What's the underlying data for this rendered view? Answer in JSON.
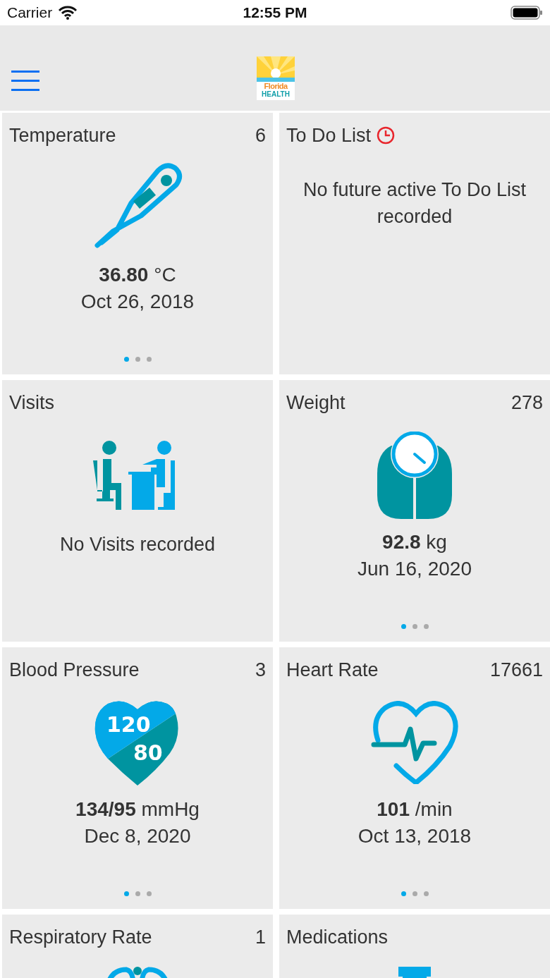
{
  "status_bar": {
    "carrier": "Carrier",
    "time": "12:55 PM"
  },
  "header": {
    "logo": {
      "line_1": "Florida",
      "line_2": "HEALTH"
    }
  },
  "tiles": [
    {
      "kind": "reading",
      "title": "Temperature",
      "count": "6",
      "value": "36.80",
      "unit": "°C",
      "date": "Oct 26, 2018",
      "pages": [
        {
          "selected": true
        },
        {
          "selected": false
        },
        {
          "selected": false
        }
      ]
    },
    {
      "kind": "message",
      "title": "To Do List",
      "message": "No future active To Do List recorded"
    },
    {
      "kind": "empty",
      "title": "Visits",
      "message": "No Visits recorded"
    },
    {
      "kind": "reading",
      "title": "Weight",
      "count": "278",
      "value": "92.8",
      "unit": "kg",
      "date": "Jun 16, 2020",
      "pages": [
        {
          "selected": true
        },
        {
          "selected": false
        },
        {
          "selected": false
        }
      ]
    },
    {
      "kind": "reading",
      "icon_text": [
        "120",
        "80"
      ],
      "title": "Blood Pressure",
      "count": "3",
      "value": "134/95",
      "unit": "mmHg",
      "date": "Dec 8, 2020",
      "pages": [
        {
          "selected": true
        },
        {
          "selected": false
        },
        {
          "selected": false
        }
      ]
    },
    {
      "kind": "reading",
      "title": "Heart Rate",
      "count": "17661",
      "value": "101",
      "unit": "/min",
      "date": "Oct 13, 2018",
      "pages": [
        {
          "selected": true
        },
        {
          "selected": false
        },
        {
          "selected": false
        }
      ]
    },
    {
      "kind": "cut",
      "title": "Respiratory Rate",
      "count": "1"
    },
    {
      "kind": "cut",
      "title": "Medications"
    }
  ]
}
